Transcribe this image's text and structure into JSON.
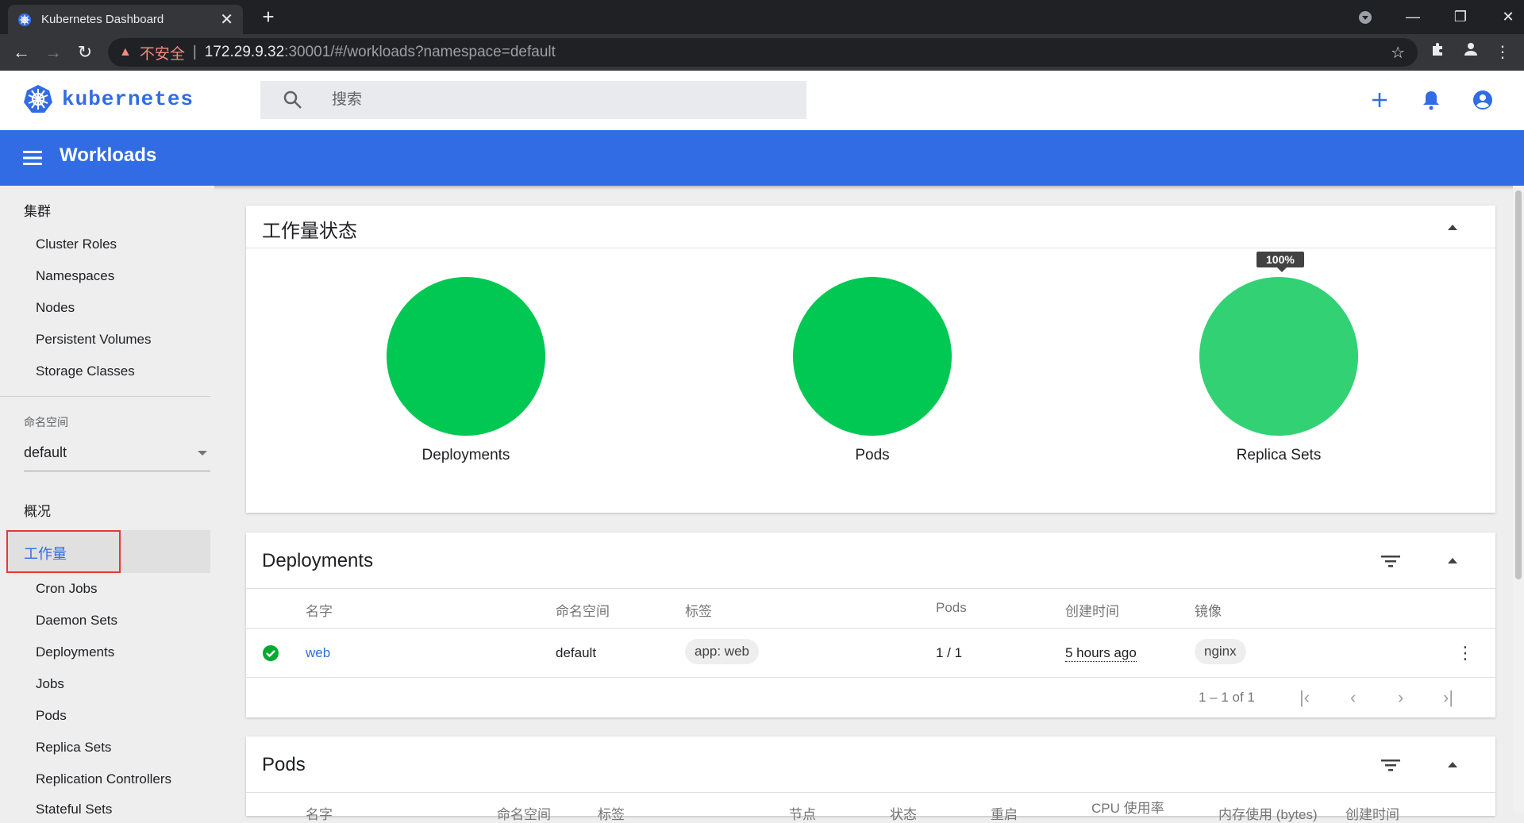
{
  "browser": {
    "tab_title": "Kubernetes Dashboard",
    "insecure_label": "不安全",
    "url_host": "172.29.9.32",
    "url_path": ":30001/#/workloads?namespace=default"
  },
  "header": {
    "brand": "kubernetes",
    "search_placeholder": "搜索"
  },
  "toolbar": {
    "title": "Workloads"
  },
  "sidebar": {
    "cluster_heading": "集群",
    "cluster_items": [
      "Cluster Roles",
      "Namespaces",
      "Nodes",
      "Persistent Volumes",
      "Storage Classes"
    ],
    "namespace_label": "命名空间",
    "namespace_value": "default",
    "overview_heading": "概况",
    "active_item": "工作量",
    "workload_items": [
      "Cron Jobs",
      "Daemon Sets",
      "Deployments",
      "Jobs",
      "Pods",
      "Replica Sets",
      "Replication Controllers",
      "Stateful Sets"
    ]
  },
  "status_card": {
    "title": "工作量状态",
    "charts": [
      {
        "label": "Deployments",
        "value": 100,
        "color": "#00c853"
      },
      {
        "label": "Pods",
        "value": 100,
        "color": "#00c853"
      },
      {
        "label": "Replica Sets",
        "value": 100,
        "color": "#32d274",
        "tooltip": "100%"
      }
    ]
  },
  "deployments_card": {
    "title": "Deployments",
    "columns": [
      "名字",
      "命名空间",
      "标签",
      "Pods",
      "创建时间",
      "镜像"
    ],
    "rows": [
      {
        "name": "web",
        "namespace": "default",
        "label": "app: web",
        "pods": "1 / 1",
        "created": "5 hours ago",
        "image": "nginx"
      }
    ],
    "pagination": "1 – 1 of 1"
  },
  "pods_card": {
    "title": "Pods",
    "columns": [
      "名字",
      "命名空间",
      "标签",
      "节点",
      "状态",
      "重启",
      "CPU 使用率",
      "内存使用 (bytes)",
      "创建时间"
    ]
  }
}
